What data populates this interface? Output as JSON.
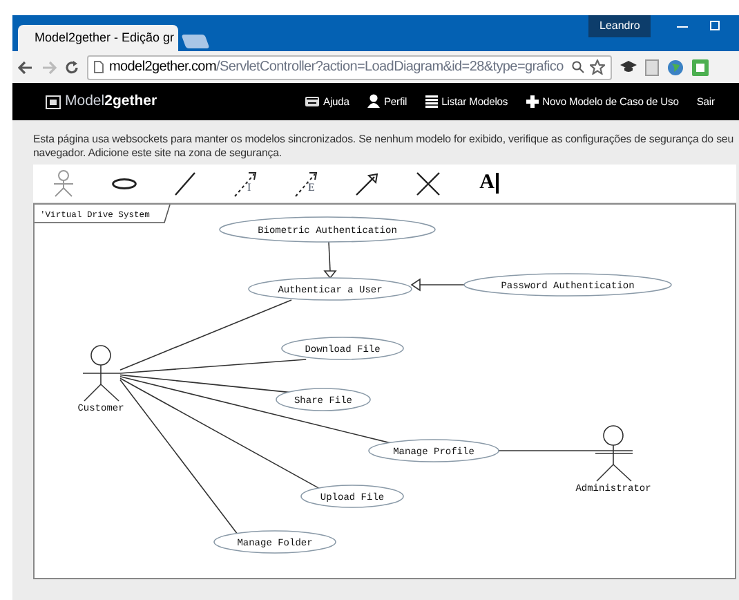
{
  "browser": {
    "profile": "Leandro",
    "tabs": [
      {
        "title": "Model2gether - Edição gr",
        "selected": true
      }
    ],
    "url_host": "model2gether.com",
    "url_path": "/ServletController?action=LoadDiagram&id=28&type=grafico"
  },
  "navbar": {
    "brand_light": "Model",
    "brand_bold": "2gether",
    "items": [
      {
        "kind": "help",
        "label": "Ajuda"
      },
      {
        "kind": "user",
        "label": "Perfil"
      },
      {
        "kind": "list",
        "label": "Listar Modelos"
      },
      {
        "kind": "plus",
        "label": "Novo Modelo de Caso de Uso"
      },
      {
        "kind": "none",
        "label": "Sair"
      }
    ]
  },
  "notice": "Esta página usa websockets para manter os modelos sincronizados. Se nenhum modelo for exibido, verifique as configurações de segurança do seu navegador. Adicione este site na zona de segurança.",
  "tools": [
    {
      "kind": "actor"
    },
    {
      "kind": "usecase"
    },
    {
      "kind": "line"
    },
    {
      "kind": "include",
      "label": "I"
    },
    {
      "kind": "extend",
      "label": "E"
    },
    {
      "kind": "generalization"
    },
    {
      "kind": "delete"
    },
    {
      "kind": "text",
      "label": "A"
    }
  ],
  "diagram": {
    "system": "'Virtual Drive System",
    "actors": [
      {
        "name": "Customer"
      },
      {
        "name": "Administrator"
      }
    ],
    "use_cases": [
      {
        "name": "Biometric Authentication"
      },
      {
        "name": "Authenticar a User"
      },
      {
        "name": "Password Authentication"
      },
      {
        "name": "Download File"
      },
      {
        "name": "Share File"
      },
      {
        "name": "Manage Profile"
      },
      {
        "name": "Upload File"
      },
      {
        "name": "Manage Folder"
      }
    ]
  }
}
